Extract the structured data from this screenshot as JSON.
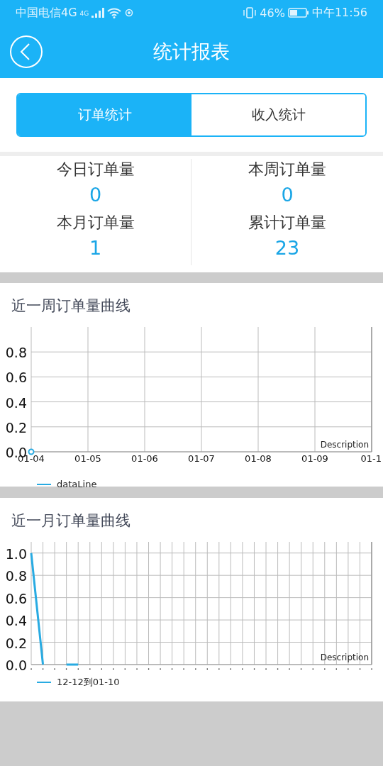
{
  "status_bar": {
    "carrier": "中国电信4G",
    "network": "4G",
    "battery": "46%",
    "time": "中午11:56"
  },
  "header": {
    "title": "统计报表"
  },
  "tabs": [
    {
      "label": "订单统计",
      "selected": true
    },
    {
      "label": "收入统计",
      "selected": false
    }
  ],
  "stats": [
    {
      "label": "今日订单量",
      "value": "0"
    },
    {
      "label": "本周订单量",
      "value": "0"
    },
    {
      "label": "本月订单量",
      "value": "1"
    },
    {
      "label": "累计订单量",
      "value": "23"
    }
  ],
  "charts": [
    {
      "title": "近一周订单量曲线",
      "description": "Description",
      "chart_data": {
        "type": "line",
        "categories": [
          "01-04",
          "01-05",
          "01-06",
          "01-07",
          "01-08",
          "01-09",
          "01-1"
        ],
        "ylim": [
          0,
          1
        ],
        "grid": true,
        "yticks": [
          {
            "value": 0,
            "label": "0.0"
          },
          {
            "value": 0.2,
            "label": "0.2"
          },
          {
            "value": 0.4,
            "label": "0.4"
          },
          {
            "value": 0.6,
            "label": "0.6"
          },
          {
            "value": 0.8,
            "label": "0.8"
          }
        ],
        "series": [
          {
            "name": "dataLine",
            "color": "#29abe2",
            "marker": true,
            "values": [
              0,
              null,
              null,
              null,
              null,
              null,
              null
            ]
          }
        ]
      }
    },
    {
      "title": "近一月订单量曲线",
      "description": "Description",
      "chart_data": {
        "type": "line",
        "categories": [
          ".",
          ".",
          ".",
          ".",
          ".",
          ".",
          ".",
          ".",
          ".",
          ".",
          ".",
          ".",
          ".",
          ".",
          ".",
          ".",
          ".",
          ".",
          ".",
          ".",
          ".",
          ".",
          ".",
          ".",
          ".",
          ".",
          ".",
          ".",
          ".",
          "."
        ],
        "ylim": [
          0,
          1.1
        ],
        "grid": true,
        "yticks": [
          {
            "value": 0,
            "label": "0.0"
          },
          {
            "value": 0.2,
            "label": "0.2"
          },
          {
            "value": 0.4,
            "label": "0.4"
          },
          {
            "value": 0.6,
            "label": "0.6"
          },
          {
            "value": 0.8,
            "label": "0.8"
          },
          {
            "value": 1.0,
            "label": "1.0"
          }
        ],
        "series": [
          {
            "name": "12-12到01-10",
            "color": "#29abe2",
            "values": [
              1,
              0,
              null,
              0,
              0,
              null,
              null,
              null,
              null,
              null,
              null,
              null,
              null,
              null,
              null,
              null,
              null,
              null,
              null,
              null,
              null,
              null,
              null,
              null,
              null,
              null,
              null,
              null,
              null,
              null
            ]
          }
        ]
      }
    }
  ]
}
